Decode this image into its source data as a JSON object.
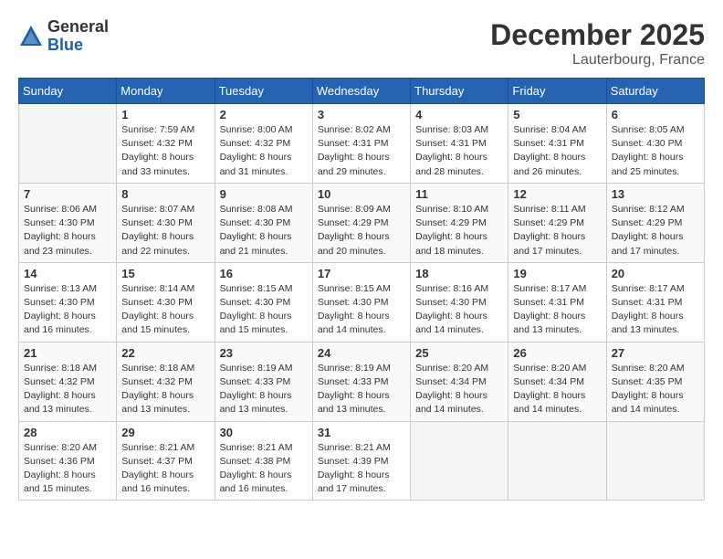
{
  "header": {
    "logo_general": "General",
    "logo_blue": "Blue",
    "month_title": "December 2025",
    "location": "Lauterbourg, France"
  },
  "days_of_week": [
    "Sunday",
    "Monday",
    "Tuesday",
    "Wednesday",
    "Thursday",
    "Friday",
    "Saturday"
  ],
  "weeks": [
    [
      {
        "day": "",
        "info": ""
      },
      {
        "day": "1",
        "info": "Sunrise: 7:59 AM\nSunset: 4:32 PM\nDaylight: 8 hours\nand 33 minutes."
      },
      {
        "day": "2",
        "info": "Sunrise: 8:00 AM\nSunset: 4:32 PM\nDaylight: 8 hours\nand 31 minutes."
      },
      {
        "day": "3",
        "info": "Sunrise: 8:02 AM\nSunset: 4:31 PM\nDaylight: 8 hours\nand 29 minutes."
      },
      {
        "day": "4",
        "info": "Sunrise: 8:03 AM\nSunset: 4:31 PM\nDaylight: 8 hours\nand 28 minutes."
      },
      {
        "day": "5",
        "info": "Sunrise: 8:04 AM\nSunset: 4:31 PM\nDaylight: 8 hours\nand 26 minutes."
      },
      {
        "day": "6",
        "info": "Sunrise: 8:05 AM\nSunset: 4:30 PM\nDaylight: 8 hours\nand 25 minutes."
      }
    ],
    [
      {
        "day": "7",
        "info": "Sunrise: 8:06 AM\nSunset: 4:30 PM\nDaylight: 8 hours\nand 23 minutes."
      },
      {
        "day": "8",
        "info": "Sunrise: 8:07 AM\nSunset: 4:30 PM\nDaylight: 8 hours\nand 22 minutes."
      },
      {
        "day": "9",
        "info": "Sunrise: 8:08 AM\nSunset: 4:30 PM\nDaylight: 8 hours\nand 21 minutes."
      },
      {
        "day": "10",
        "info": "Sunrise: 8:09 AM\nSunset: 4:29 PM\nDaylight: 8 hours\nand 20 minutes."
      },
      {
        "day": "11",
        "info": "Sunrise: 8:10 AM\nSunset: 4:29 PM\nDaylight: 8 hours\nand 18 minutes."
      },
      {
        "day": "12",
        "info": "Sunrise: 8:11 AM\nSunset: 4:29 PM\nDaylight: 8 hours\nand 17 minutes."
      },
      {
        "day": "13",
        "info": "Sunrise: 8:12 AM\nSunset: 4:29 PM\nDaylight: 8 hours\nand 17 minutes."
      }
    ],
    [
      {
        "day": "14",
        "info": "Sunrise: 8:13 AM\nSunset: 4:30 PM\nDaylight: 8 hours\nand 16 minutes."
      },
      {
        "day": "15",
        "info": "Sunrise: 8:14 AM\nSunset: 4:30 PM\nDaylight: 8 hours\nand 15 minutes."
      },
      {
        "day": "16",
        "info": "Sunrise: 8:15 AM\nSunset: 4:30 PM\nDaylight: 8 hours\nand 15 minutes."
      },
      {
        "day": "17",
        "info": "Sunrise: 8:15 AM\nSunset: 4:30 PM\nDaylight: 8 hours\nand 14 minutes."
      },
      {
        "day": "18",
        "info": "Sunrise: 8:16 AM\nSunset: 4:30 PM\nDaylight: 8 hours\nand 14 minutes."
      },
      {
        "day": "19",
        "info": "Sunrise: 8:17 AM\nSunset: 4:31 PM\nDaylight: 8 hours\nand 13 minutes."
      },
      {
        "day": "20",
        "info": "Sunrise: 8:17 AM\nSunset: 4:31 PM\nDaylight: 8 hours\nand 13 minutes."
      }
    ],
    [
      {
        "day": "21",
        "info": "Sunrise: 8:18 AM\nSunset: 4:32 PM\nDaylight: 8 hours\nand 13 minutes."
      },
      {
        "day": "22",
        "info": "Sunrise: 8:18 AM\nSunset: 4:32 PM\nDaylight: 8 hours\nand 13 minutes."
      },
      {
        "day": "23",
        "info": "Sunrise: 8:19 AM\nSunset: 4:33 PM\nDaylight: 8 hours\nand 13 minutes."
      },
      {
        "day": "24",
        "info": "Sunrise: 8:19 AM\nSunset: 4:33 PM\nDaylight: 8 hours\nand 13 minutes."
      },
      {
        "day": "25",
        "info": "Sunrise: 8:20 AM\nSunset: 4:34 PM\nDaylight: 8 hours\nand 14 minutes."
      },
      {
        "day": "26",
        "info": "Sunrise: 8:20 AM\nSunset: 4:34 PM\nDaylight: 8 hours\nand 14 minutes."
      },
      {
        "day": "27",
        "info": "Sunrise: 8:20 AM\nSunset: 4:35 PM\nDaylight: 8 hours\nand 14 minutes."
      }
    ],
    [
      {
        "day": "28",
        "info": "Sunrise: 8:20 AM\nSunset: 4:36 PM\nDaylight: 8 hours\nand 15 minutes."
      },
      {
        "day": "29",
        "info": "Sunrise: 8:21 AM\nSunset: 4:37 PM\nDaylight: 8 hours\nand 16 minutes."
      },
      {
        "day": "30",
        "info": "Sunrise: 8:21 AM\nSunset: 4:38 PM\nDaylight: 8 hours\nand 16 minutes."
      },
      {
        "day": "31",
        "info": "Sunrise: 8:21 AM\nSunset: 4:39 PM\nDaylight: 8 hours\nand 17 minutes."
      },
      {
        "day": "",
        "info": ""
      },
      {
        "day": "",
        "info": ""
      },
      {
        "day": "",
        "info": ""
      }
    ]
  ]
}
